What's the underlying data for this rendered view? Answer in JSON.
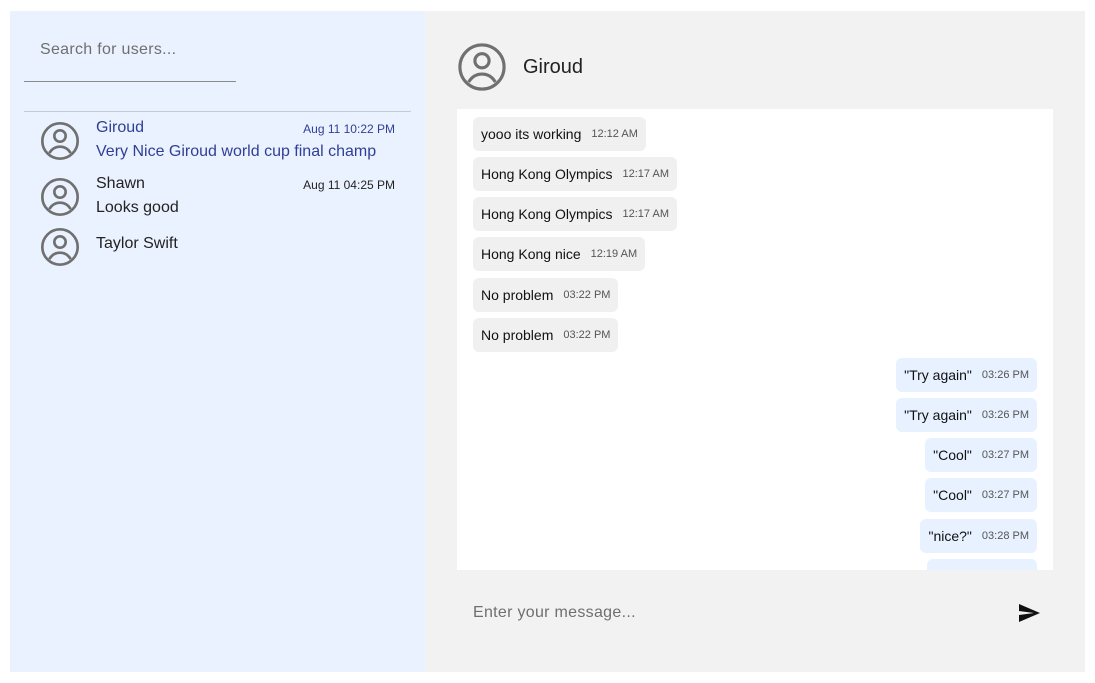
{
  "search": {
    "placeholder": "Search for users..."
  },
  "conversations": [
    {
      "name": "Giroud",
      "time": "Aug 11 10:22 PM",
      "preview": "Very Nice Giroud world cup final champ",
      "active": true
    },
    {
      "name": "Shawn",
      "time": "Aug 11 04:25 PM",
      "preview": "Looks good",
      "active": false
    },
    {
      "name": "Taylor Swift",
      "time": "",
      "preview": "",
      "active": false
    }
  ],
  "chat": {
    "title": "Giroud",
    "messages": [
      {
        "text": "yooo its working",
        "time": "12:12 AM",
        "direction": "in"
      },
      {
        "text": "Hong Kong Olympics",
        "time": "12:17 AM",
        "direction": "in"
      },
      {
        "text": "Hong Kong Olympics",
        "time": "12:17 AM",
        "direction": "in"
      },
      {
        "text": "Hong Kong nice",
        "time": "12:19 AM",
        "direction": "in"
      },
      {
        "text": "No problem",
        "time": "03:22 PM",
        "direction": "in"
      },
      {
        "text": "No problem",
        "time": "03:22 PM",
        "direction": "in"
      },
      {
        "text": "\"Try again\"",
        "time": "03:26 PM",
        "direction": "out"
      },
      {
        "text": "\"Try again\"",
        "time": "03:26 PM",
        "direction": "out"
      },
      {
        "text": "\"Cool\"",
        "time": "03:27 PM",
        "direction": "out"
      },
      {
        "text": "\"Cool\"",
        "time": "03:27 PM",
        "direction": "out"
      },
      {
        "text": "\"nice?\"",
        "time": "03:28 PM",
        "direction": "out"
      }
    ]
  },
  "composer": {
    "placeholder": "Enter your message..."
  },
  "icons": {
    "avatar": "account-circle-icon",
    "send": "send-icon"
  },
  "colors": {
    "sidebar_bg": "#ebf2ff",
    "chat_bg": "#f2f2f2",
    "active_text": "#2f3f97",
    "incoming_bubble": "#f0f0f0",
    "outgoing_bubble": "#e8f1ff"
  }
}
